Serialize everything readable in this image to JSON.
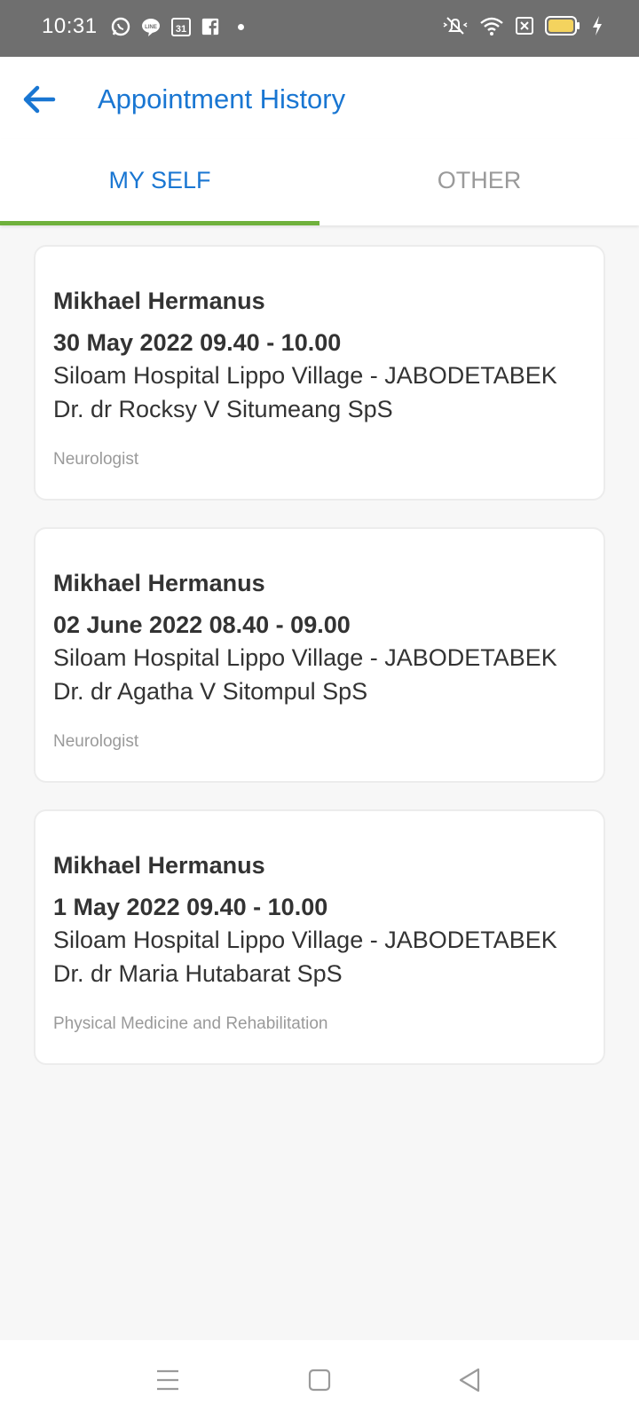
{
  "status_bar": {
    "time": "10:31",
    "left_icons": [
      "whatsapp-icon",
      "line-icon",
      "calendar-icon",
      "facebook-icon",
      "notification-dot-icon"
    ],
    "right_icons": [
      "mute-icon",
      "wifi-icon",
      "sim-no-signal-icon",
      "battery-icon",
      "charging-icon"
    ],
    "calendar_day": "31"
  },
  "header": {
    "title": "Appointment History",
    "back_icon": "arrow-left-icon",
    "accent_color": "#1976d2"
  },
  "tabs": [
    {
      "label": "MY SELF",
      "active": true
    },
    {
      "label": "OTHER",
      "active": false
    }
  ],
  "tab_indicator_color": "#6fb13c",
  "appointments": [
    {
      "patient": "Mikhael Hermanus",
      "datetime": "30 May 2022 09.40 - 10.00",
      "hospital": "Siloam Hospital Lippo Village - JABODETABEK",
      "doctor": "Dr. dr Rocksy V Situmeang SpS",
      "specialty": "Neurologist"
    },
    {
      "patient": "Mikhael Hermanus",
      "datetime": "02 June 2022 08.40 - 09.00",
      "hospital": "Siloam Hospital Lippo Village - JABODETABEK",
      "doctor": "Dr. dr Agatha V Sitompul SpS",
      "specialty": "Neurologist"
    },
    {
      "patient": "Mikhael Hermanus",
      "datetime": "1 May 2022 09.40 - 10.00",
      "hospital": "Siloam Hospital Lippo Village - JABODETABEK",
      "doctor": "Dr. dr Maria Hutabarat SpS",
      "specialty": "Physical Medicine and Rehabilitation"
    }
  ],
  "nav_bar": {
    "icons": [
      "menu-icon",
      "home-square-icon",
      "back-triangle-icon"
    ]
  }
}
